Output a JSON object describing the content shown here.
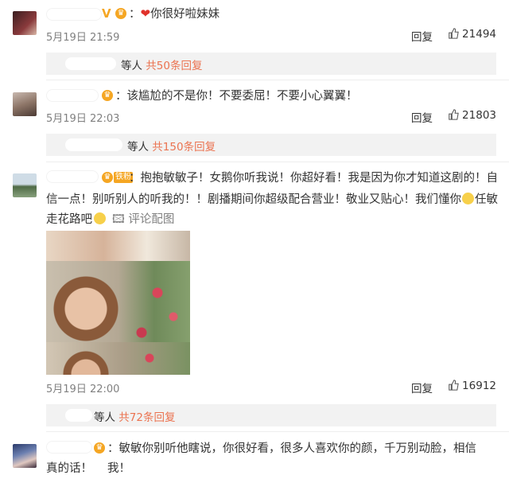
{
  "comments": [
    {
      "text_prefix": "你很好啦妹妹",
      "date": "5月19日 21:59",
      "reply_label": "回复",
      "likes": "21494",
      "sub_replies": {
        "suffix": "等人",
        "link": "共50条回复"
      }
    },
    {
      "text": "该尴尬的不是你！不要委屈！不要小心翼翼！",
      "date": "5月19日 22:03",
      "reply_label": "回复",
      "likes": "21803",
      "sub_replies": {
        "suffix": "等人",
        "link": "共150条回复"
      }
    },
    {
      "badge_label": "铁粉",
      "text_line1": "抱抱敏敏子！女鹅你听我说！你超好看！我是因为你才知道这剧的！自",
      "text_line2": "信一点！别听别人的听我的！！剧播期间你超级配合营业！敬业又贴心！我们懂你",
      "text_line2_tail": "任敏",
      "text_line3": "走花路吧",
      "image_link": "评论配图",
      "date": "5月19日 22:00",
      "reply_label": "回复",
      "likes": "16912",
      "sub_replies": {
        "suffix": "等人",
        "link": "共72条回复"
      }
    },
    {
      "text_line1": "敏敏你别听他瞎说，你很好看，很多人喜欢你的颜，千万别动脸，相信我！",
      "text_line2": "真的话！"
    }
  ],
  "colors": {
    "link": "#eb7350",
    "meta": "#808080",
    "subbar_bg": "#f2f2f2",
    "badge": "#f5a623"
  }
}
